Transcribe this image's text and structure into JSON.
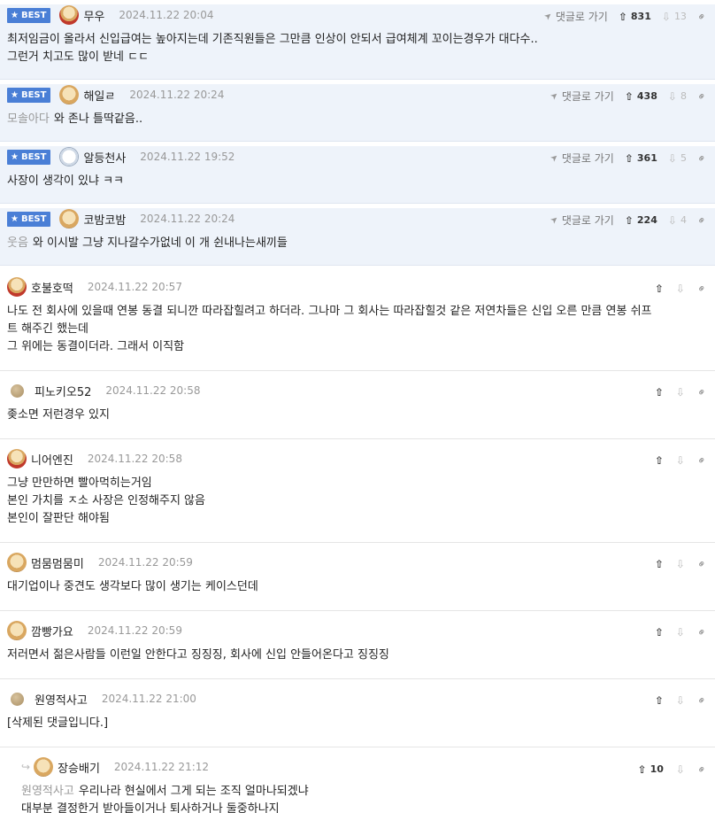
{
  "best_comments": [
    {
      "badge": "BEST",
      "nick": "무우",
      "date": "2024.11.22 20:04",
      "reply_label": "댓글로 가기",
      "up": "831",
      "down": "13",
      "avatar": "dog-red",
      "mention": "",
      "lines": [
        "최저임금이 올라서 신입급여는 높아지는데 기존직원들은 그만큼 인상이 안되서 급여체계 꼬이는경우가 대다수..",
        "그런거 치고도 많이 받네 ㄷㄷ"
      ]
    },
    {
      "badge": "BEST",
      "nick": "해일ㄹ",
      "date": "2024.11.22 20:24",
      "reply_label": "댓글로 가기",
      "up": "438",
      "down": "8",
      "avatar": "dog",
      "mention": "모솔아다",
      "lines": [
        "와 존나 틀딱같음.."
      ]
    },
    {
      "badge": "BEST",
      "nick": "알등천사",
      "date": "2024.11.22 19:52",
      "reply_label": "댓글로 가기",
      "up": "361",
      "down": "5",
      "avatar": "bear",
      "mention": "",
      "lines": [
        "사장이 생각이 있냐 ㅋㅋ"
      ]
    },
    {
      "badge": "BEST",
      "nick": "코밤코밤",
      "date": "2024.11.22 20:24",
      "reply_label": "댓글로 가기",
      "up": "224",
      "down": "4",
      "avatar": "dog",
      "mention": "웃음",
      "lines": [
        "와 이시발 그냥 지나갈수가없네 이 개 쉰내나는새끼들"
      ]
    }
  ],
  "comments": [
    {
      "nick": "호불호떡",
      "date": "2024.11.22 20:57",
      "avatar": "dog-red",
      "lines": [
        "나도 전 회사에 있을때 연봉 동결 되니깐 따라잡힐려고 하더라. 그나마 그 회사는 따라잡힐것 같은 저연차들은 신입 오른 만큼 연봉 쉬프",
        "트 해주긴 했는데",
        "그 위에는 동결이더라. 그래서 이직함"
      ]
    },
    {
      "nick": "피노키오52",
      "date": "2024.11.22 20:58",
      "avatar": "ball",
      "lines": [
        "좆소면 저런경우 있지"
      ]
    },
    {
      "nick": "니어엔진",
      "date": "2024.11.22 20:58",
      "avatar": "dog-red",
      "lines": [
        "그냥 만만하면 빨아먹히는거임",
        "본인 가치를 ㅈ소 사장은 인정해주지 않음",
        "본인이 잘판단 해야됨"
      ]
    },
    {
      "nick": "멈뭄멈뭄미",
      "date": "2024.11.22 20:59",
      "avatar": "dog",
      "lines": [
        "대기업이나 중견도 생각보다 많이 생기는 케이스던데"
      ]
    },
    {
      "nick": "깜빵가요",
      "date": "2024.11.22 20:59",
      "avatar": "dog",
      "lines": [
        "저러면서 젊은사람들 이런일 안한다고 징징징, 회사에 신입 안들어온다고 징징징"
      ]
    },
    {
      "nick": "원영적사고",
      "date": "2024.11.22 21:00",
      "avatar": "ball",
      "lines": [
        "[삭제된 댓글입니다.]"
      ]
    }
  ],
  "reply": {
    "nick": "장승배기",
    "date": "2024.11.22 21:12",
    "up": "10",
    "avatar": "dog",
    "mention": "원영적사고",
    "lines": [
      "우리나라 현실에서 그게 되는 조직 얼마나되겠냐",
      "대부분 결정한거 받아들이거나 퇴사하거나 둘중하나지"
    ]
  },
  "icons": {
    "best": "star-icon",
    "reply": "send-icon",
    "up": "thumb-up-icon",
    "down": "thumb-down-icon",
    "link": "link-icon",
    "child": "reply-arrow-icon"
  },
  "colors": {
    "best_badge": "#4a7fd6",
    "best_bg": "#eef3fa",
    "mention": "#999999"
  }
}
